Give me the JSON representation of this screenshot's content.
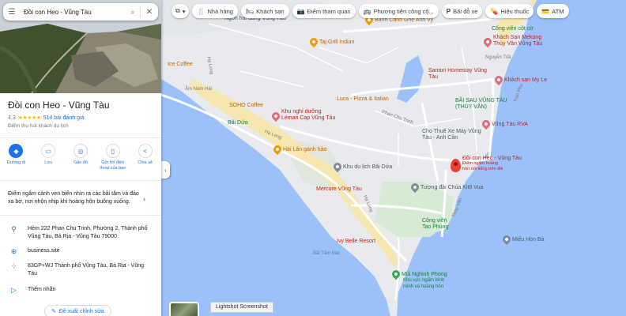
{
  "search": {
    "query": "Đồi con Heo - Vũng Tàu"
  },
  "place": {
    "title": "Đồi con Heo - Vũng Tàu",
    "rating": "4,3",
    "stars": "★★★★★",
    "reviews": "514 bài đánh giá",
    "category": "Điểm thu hút khách du lịch",
    "description": "Điểm ngắm cảnh ven biển nhìn ra các bãi tắm và đảo xa bờ, nơi nhộn nhịp khi hoàng hôn buông xuống."
  },
  "actions": [
    {
      "label": "Đường đi",
      "icon": "directions-icon",
      "glyph": "◆"
    },
    {
      "label": "Lưu",
      "icon": "bookmark-icon",
      "glyph": "▭"
    },
    {
      "label": "Gần đó",
      "icon": "nearby-icon",
      "glyph": "◎"
    },
    {
      "label": "Gửi tới điện thoại của bạn",
      "icon": "phone-icon",
      "glyph": "▯"
    },
    {
      "label": "Chia sẻ",
      "icon": "share-icon",
      "glyph": "<"
    }
  ],
  "info": {
    "address": "Hẻm 222 Phan Chu Trinh, Phường 2, Thành phố Vũng Tàu, Bà Rịa - Vũng Tàu 79000",
    "website": "business.site",
    "pluscode": "83GP+WJ Thành phố Vũng Tàu, Bà Rịa - Vũng Tàu",
    "add_label": "Thêm nhãn"
  },
  "suggest_edit": "Đề xuất chỉnh sửa",
  "chips": [
    {
      "label": "Nhà hàng",
      "icon": "restaurant-icon",
      "glyph": "🍴"
    },
    {
      "label": "Khách sạn",
      "icon": "hotel-icon",
      "glyph": "🛏"
    },
    {
      "label": "Điểm tham quan",
      "icon": "attraction-icon",
      "glyph": "📷"
    },
    {
      "label": "Phương tiện công cộ...",
      "icon": "transit-icon",
      "glyph": "🚌"
    },
    {
      "label": "Bãi đỗ xe",
      "icon": "parking-icon",
      "glyph": "P"
    },
    {
      "label": "Hiệu thuốc",
      "icon": "pharmacy-icon",
      "glyph": "💊"
    },
    {
      "label": "ATM",
      "icon": "atm-icon",
      "glyph": "💳"
    }
  ],
  "map": {
    "main_pin": {
      "line1": "Đồi con Heo - Vũng Tàu",
      "line2": "Điểm ngắm hoàng",
      "line3": "hôn nổi tiếng trên đồi"
    },
    "pins": [
      {
        "label": "Ngon hải đăng Vũng Tàu",
        "color": "grey"
      },
      {
        "label": "Bánh Canh Ghẹ Anh Vy",
        "color": "orange"
      },
      {
        "label": "Công viên cột cờ",
        "color": "green"
      },
      {
        "label": "Khách Sạn Mekong Thủy Vân Vũng Tàu",
        "color": "red"
      },
      {
        "label": "Taj Grill Indian",
        "color": "orange"
      },
      {
        "label": "Ice Coffee",
        "color": "orange"
      },
      {
        "label": "Santori Homestay Vũng Tàu",
        "color": "red"
      },
      {
        "label": "Khách sạn My Le",
        "color": "red"
      },
      {
        "label": "Khu nghỉ dưỡng Léman Cap Vũng Tàu",
        "color": "red"
      },
      {
        "label": "SOHO Coffee",
        "color": "orange"
      },
      {
        "label": "Luca - Pizza & Italian",
        "color": "orange"
      },
      {
        "label": "BÃI SAU VŨNG TÀU (THÙY VÂN)",
        "color": "green"
      },
      {
        "label": "Bãi Dứa",
        "color": "green"
      },
      {
        "label": "Cho Thuê Xe Máy Vũng Tàu - Anh Cần",
        "color": "grey"
      },
      {
        "label": "Vũng Tàu RVA",
        "color": "red"
      },
      {
        "label": "Hải Lân gánh hảo",
        "color": "orange"
      },
      {
        "label": "Khu du lịch Bãi Dứa",
        "color": "grey"
      },
      {
        "label": "Mercure Vũng Tàu",
        "color": "red"
      },
      {
        "label": "Tượng đài Chúa Kitô Vua",
        "color": "grey"
      },
      {
        "label": "Công viên Tao Phùng",
        "color": "green"
      },
      {
        "label": "Miếu Hòn Bà",
        "color": "grey"
      },
      {
        "label": "Ivy Belle Resort",
        "color": "red"
      },
      {
        "label": "Mũi Nghinh Phong",
        "color": "green"
      },
      {
        "label": "Khu vực ngắm bình minh và hoàng hôn",
        "color": "green"
      }
    ],
    "roads": [
      "Hạ Long",
      "Hạ Long",
      "Hạ Long",
      "Thùy Vân",
      "Phan Chu Trinh",
      "Nguyễn Trãi",
      "Tran Phu"
    ],
    "water": "Bãi Tắm Mai",
    "anchorage": "Âm Nam Hải"
  },
  "overlay": {
    "tooltip": "Lightshot Screenshot"
  }
}
